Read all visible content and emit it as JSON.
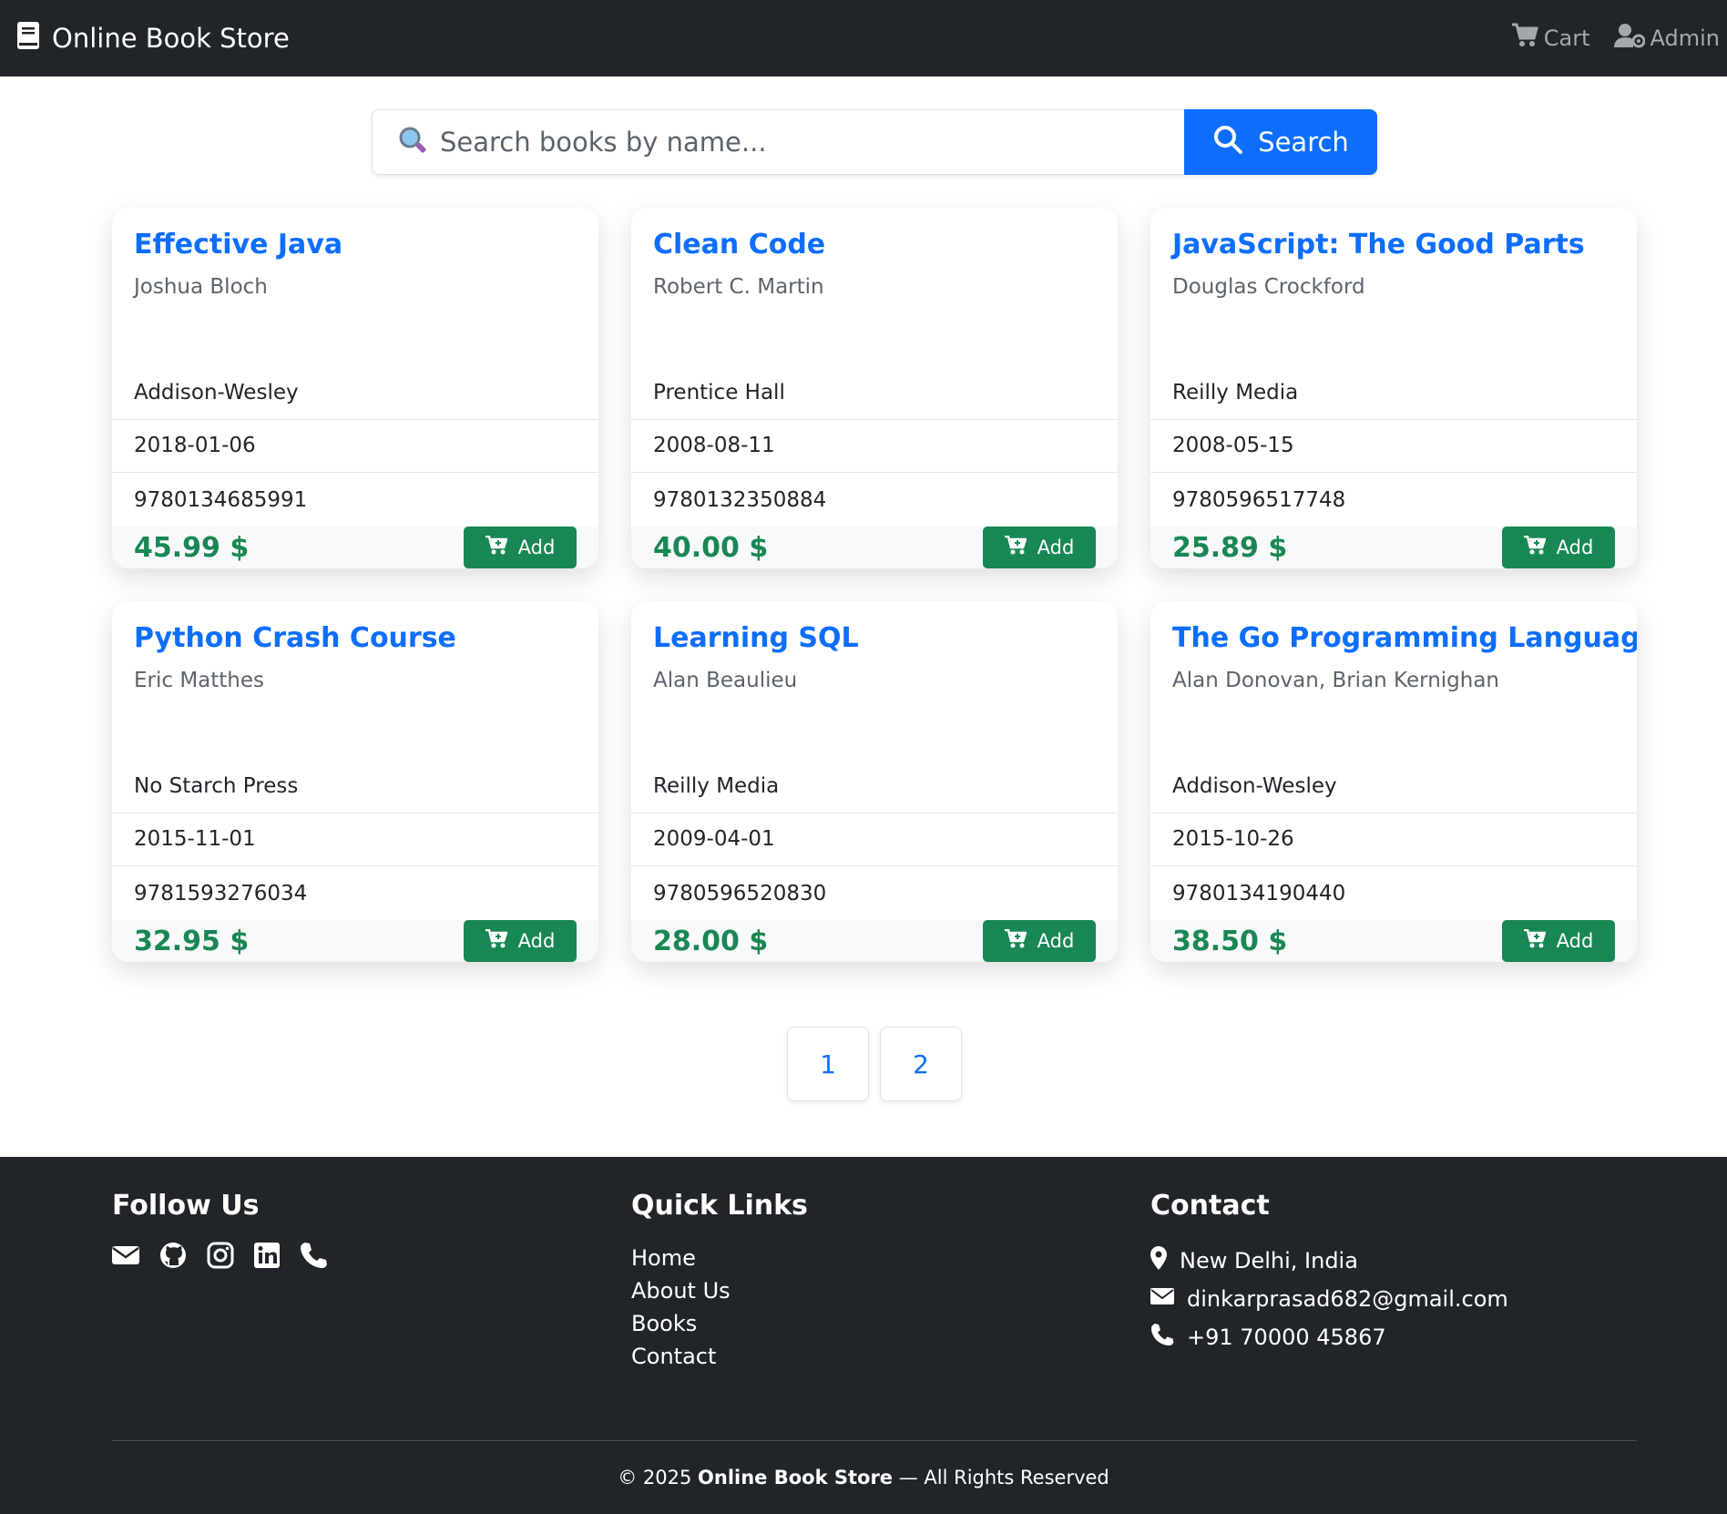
{
  "navbar": {
    "brand": "Online Book Store",
    "cart_label": "Cart",
    "admin_label": "Admin"
  },
  "search": {
    "placeholder": "Search books by name...",
    "button_label": "Search"
  },
  "books": [
    {
      "title": "Effective Java",
      "author": "Joshua Bloch",
      "publisher": "Addison-Wesley",
      "date": "2018-01-06",
      "isbn": "9780134685991",
      "price": "45.99 $",
      "add_label": "Add"
    },
    {
      "title": "Clean Code",
      "author": "Robert C. Martin",
      "publisher": "Prentice Hall",
      "date": "2008-08-11",
      "isbn": "9780132350884",
      "price": "40.00 $",
      "add_label": "Add"
    },
    {
      "title": "JavaScript: The Good Parts",
      "author": "Douglas Crockford",
      "publisher": "Reilly Media",
      "date": "2008-05-15",
      "isbn": "9780596517748",
      "price": "25.89 $",
      "add_label": "Add"
    },
    {
      "title": "Python Crash Course",
      "author": "Eric Matthes",
      "publisher": "No Starch Press",
      "date": "2015-11-01",
      "isbn": "9781593276034",
      "price": "32.95 $",
      "add_label": "Add"
    },
    {
      "title": "Learning SQL",
      "author": "Alan Beaulieu",
      "publisher": "Reilly Media",
      "date": "2009-04-01",
      "isbn": "9780596520830",
      "price": "28.00 $",
      "add_label": "Add"
    },
    {
      "title": "The Go Programming Language",
      "author": "Alan Donovan, Brian Kernighan",
      "publisher": "Addison-Wesley",
      "date": "2015-10-26",
      "isbn": "9780134190440",
      "price": "38.50 $",
      "add_label": "Add"
    }
  ],
  "pagination": {
    "pages": [
      "1",
      "2"
    ]
  },
  "footer": {
    "follow_title": "Follow Us",
    "social_icons": [
      "envelope-icon",
      "github-icon",
      "instagram-icon",
      "linkedin-icon",
      "phone-icon"
    ],
    "links_title": "Quick Links",
    "links": [
      "Home",
      "About Us",
      "Books",
      "Contact"
    ],
    "contact_title": "Contact",
    "location": "New Delhi, India",
    "email": "dinkarprasad682@gmail.com",
    "phone": "+91 70000 45867",
    "copyright_prefix": "© 2025 ",
    "copyright_brand": "Online Book Store",
    "copyright_suffix": " — All Rights Reserved"
  },
  "colors": {
    "navbar_bg": "#212529",
    "primary": "#0d6efd",
    "success": "#198754",
    "footer_bg": "#212529"
  }
}
